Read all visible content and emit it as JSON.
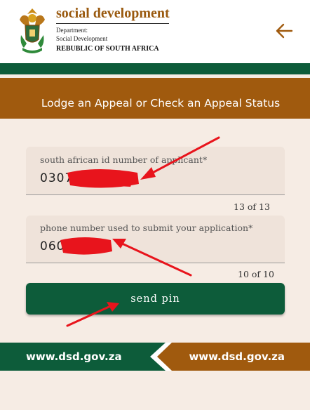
{
  "header": {
    "brand_title": "social development",
    "department_line1": "Department:",
    "department_line2": "Social Development",
    "department_line3": "REBUBLIC OF SOUTH AFRICA",
    "crest_icon": "coat-of-arms-icon",
    "back_icon": "arrow-left-icon"
  },
  "banner": {
    "title": "Lodge an Appeal or Check an Appeal Status"
  },
  "form": {
    "id_field": {
      "label": "south african id number of applicant*",
      "value": "03073",
      "counter": "13 of 13"
    },
    "phone_field": {
      "label": "phone number used to submit your application*",
      "value": "060",
      "counter": "10 of 10"
    },
    "send_pin_label": "send pin"
  },
  "footer": {
    "left_link": "www.dsd.gov.za",
    "right_link": "www.dsd.gov.za"
  },
  "colors": {
    "brand_green": "#0d5c3a",
    "brand_brown": "#a05a0e",
    "page_bg": "#f6ece4",
    "field_bg": "#efe3da",
    "annotation_red": "#e8141c"
  }
}
